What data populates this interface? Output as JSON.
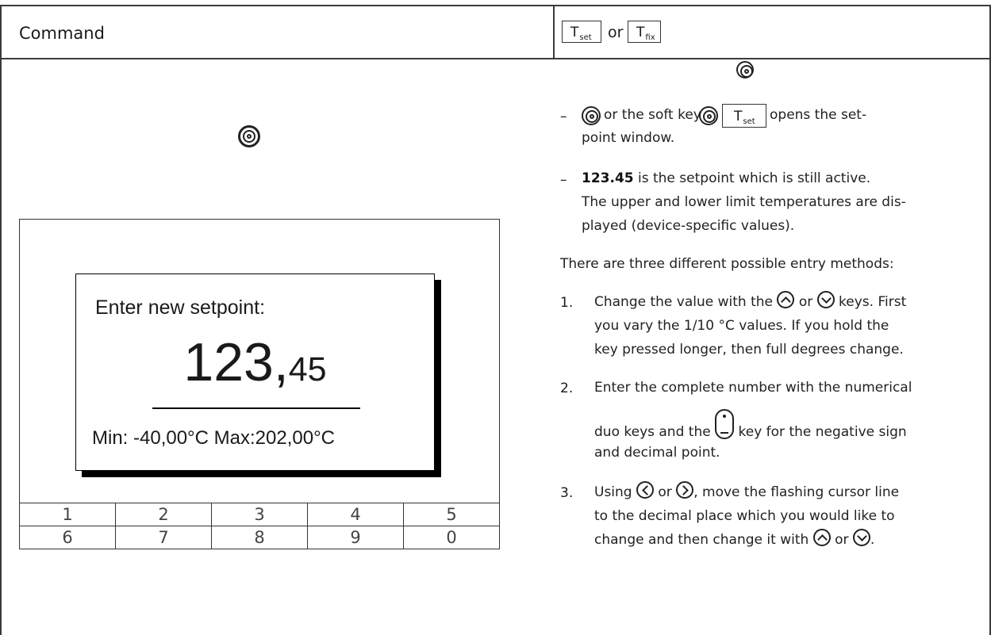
{
  "header": {
    "command_label": "Command",
    "key1": {
      "main": "T",
      "sub": "set"
    },
    "or_text": "or",
    "key2": {
      "main": "T",
      "sub": "fix"
    }
  },
  "icons": {
    "dial": "rotary-knob-icon",
    "up": "arrow-up-key-icon",
    "down": "arrow-down-key-icon",
    "left": "arrow-left-key-icon",
    "right": "arrow-right-key-icon",
    "minus": "minus-decimal-key-icon"
  },
  "screen": {
    "popup_title": "Enter new setpoint:",
    "value_int": "123,",
    "value_frac": "45",
    "range_text": "Min: -40,00°C  Max:202,00°C",
    "keypad_row1": [
      "1",
      "2",
      "3",
      "4",
      "5"
    ],
    "keypad_row2": [
      "6",
      "7",
      "8",
      "9",
      "0"
    ]
  },
  "text": {
    "b1_a": "or the soft key",
    "b1_key": {
      "main": "T",
      "sub": "set"
    },
    "b1_b": "opens the set-",
    "b1_c": "point window.",
    "b2_bold": "123.45",
    "b2_a": " is the setpoint which is still active.",
    "b2_b": "The upper and lower limit temperatures are dis-",
    "b2_c": "played (device-specific values).",
    "intro": "There are three different possible entry methods:",
    "s1_num": "1.",
    "s1_a1": "Change the value with the",
    "s1_a2": "or",
    "s1_a3": "keys. First",
    "s1_b": "you vary the 1/10 °C values. If you hold the",
    "s1_c": "key pressed longer, then full degrees change.",
    "s2_num": "2.",
    "s2_a": "Enter the complete number with the numerical",
    "s2_b1": "duo keys and the",
    "s2_b2": "key for the negative sign",
    "s2_c": "and decimal point.",
    "s3_num": "3.",
    "s3_a1": "Using",
    "s3_a2": "or",
    "s3_a3": ", move the flashing cursor line",
    "s3_b": "to the decimal place which you would like to",
    "s3_c1": "change and then change it with",
    "s3_c2": "or",
    "s3_c3": "."
  }
}
